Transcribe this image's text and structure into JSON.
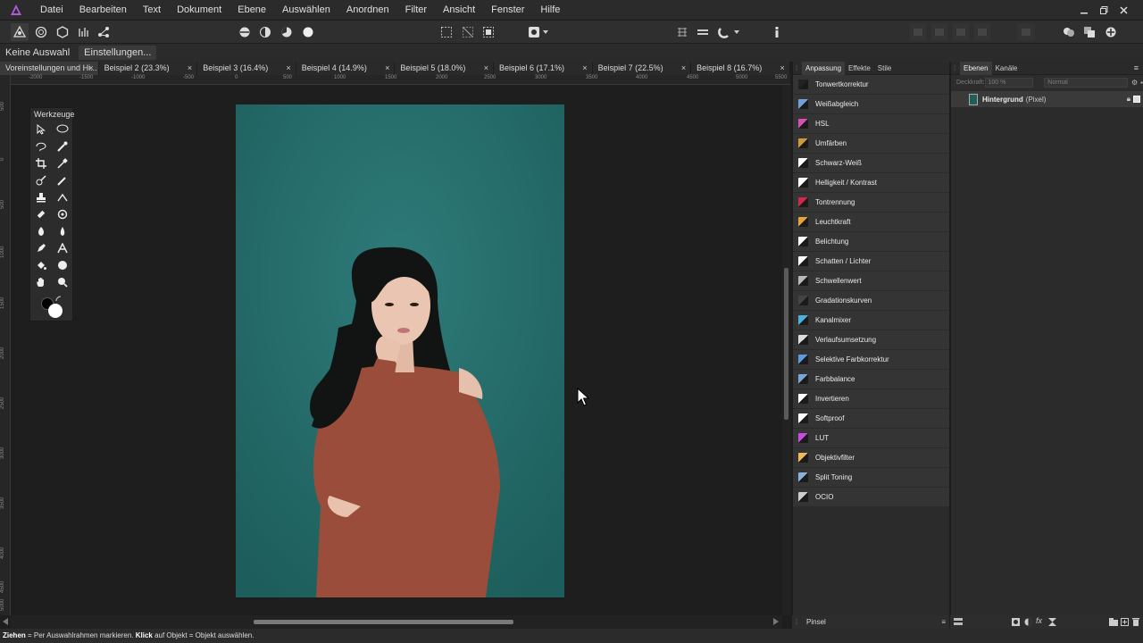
{
  "menubar": {
    "items": [
      "Datei",
      "Bearbeiten",
      "Text",
      "Dokument",
      "Ebene",
      "Auswählen",
      "Anordnen",
      "Filter",
      "Ansicht",
      "Fenster",
      "Hilfe"
    ]
  },
  "contextbar": {
    "selection_label": "Keine Auswahl",
    "settings_button": "Einstellungen..."
  },
  "tabs": [
    {
      "label": "Voreinstellungen und Hi...",
      "active": true
    },
    {
      "label": "Beispiel 2 (23.3%)"
    },
    {
      "label": "Beispiel 3 (16.4%)"
    },
    {
      "label": "Beispiel 4 (14.9%)"
    },
    {
      "label": "Beispiel 5 (18.0%)"
    },
    {
      "label": "Beispiel 6 (17.1%)"
    },
    {
      "label": "Beispiel 7 (22.5%)"
    },
    {
      "label": "Beispiel 8 (16.7%)"
    }
  ],
  "tab_close_glyph": "×",
  "ruler": {
    "h_labels": [
      "-2000",
      "-1500",
      "-1000",
      "-500",
      "0",
      "500",
      "1000",
      "1500",
      "2000",
      "2500",
      "3000",
      "3500",
      "4000",
      "4500",
      "5000",
      "5500"
    ],
    "v_labels": [
      "500",
      "0",
      "500",
      "1000",
      "1500",
      "2000",
      "2500",
      "3000",
      "3500",
      "4000",
      "4500",
      "5000"
    ]
  },
  "tools_panel": {
    "title": "Werkzeuge"
  },
  "adjustment_panel": {
    "tabs": [
      "Anpassung",
      "Effekte",
      "Stile"
    ],
    "items": [
      {
        "label": "Tonwertkorrektur",
        "color": "#222222"
      },
      {
        "label": "Weißabgleich",
        "color": "#6fa0d8"
      },
      {
        "label": "HSL",
        "color": "#d94fb0"
      },
      {
        "label": "Umfärben",
        "color": "#cf9a3d"
      },
      {
        "label": "Schwarz-Weiß",
        "color": "#ffffff"
      },
      {
        "label": "Helligkeit / Kontrast",
        "color": "#ffffff"
      },
      {
        "label": "Tontrennung",
        "color": "#d0294e"
      },
      {
        "label": "Leuchtkraft",
        "color": "#e8a23a"
      },
      {
        "label": "Belichtung",
        "color": "#ffffff"
      },
      {
        "label": "Schatten / Lichter",
        "color": "#ffffff"
      },
      {
        "label": "Schwellenwert",
        "color": "#b8b8b8"
      },
      {
        "label": "Gradationskurven",
        "color": "#444444"
      },
      {
        "label": "Kanalmixer",
        "color": "#4bb0e0"
      },
      {
        "label": "Verlaufsumsetzung",
        "color": "#dddddd"
      },
      {
        "label": "Selektive Farbkorrektur",
        "color": "#5d9be0"
      },
      {
        "label": "Farbbalance",
        "color": "#7aa7d8"
      },
      {
        "label": "Invertieren",
        "color": "#ffffff"
      },
      {
        "label": "Softproof",
        "color": "#ffffff"
      },
      {
        "label": "LUT",
        "color": "#c94be0"
      },
      {
        "label": "Objektivfilter",
        "color": "#f0b85a"
      },
      {
        "label": "Split Toning",
        "color": "#8ab0e0"
      },
      {
        "label": "OCIO",
        "color": "#cccccc"
      }
    ]
  },
  "layers_panel": {
    "tabs": [
      "Ebenen",
      "Kanäle"
    ],
    "opacity_label": "Deckkraft:",
    "opacity_value": "100 %",
    "blend_mode": "Normal",
    "layer_name": "Hintergrund",
    "layer_type": "(Pixel)"
  },
  "brush_panel": {
    "label": "Pinsel"
  },
  "status_bar": {
    "bold1": "Ziehen",
    "text1": " = Per Auswahlrahmen markieren. ",
    "bold2": "Klick",
    "text2": " auf Objekt = Objekt auswählen."
  },
  "colors": {
    "photo_background": "#236a68",
    "dress": "#9a4d3a",
    "skin": "#e9c4b0",
    "hair": "#121414"
  }
}
